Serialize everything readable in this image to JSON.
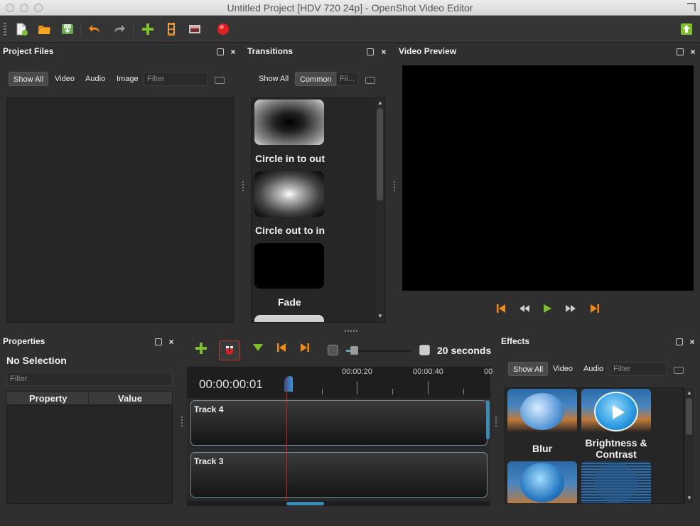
{
  "window": {
    "title": "Untitled Project [HDV 720 24p] - OpenShot Video Editor"
  },
  "toolbar": {
    "icons": [
      "new-project-icon",
      "open-project-icon",
      "save-project-icon",
      "undo-icon",
      "redo-icon",
      "import-files-icon",
      "choose-profile-icon",
      "fullscreen-icon",
      "export-video-icon",
      "update-icon"
    ]
  },
  "project_files": {
    "title": "Project Files",
    "tabs": [
      "Show All",
      "Video",
      "Audio",
      "Image"
    ],
    "active_tab": "Show All",
    "filter_placeholder": "Filter"
  },
  "transitions": {
    "title": "Transitions",
    "tabs": [
      "Show All",
      "Common"
    ],
    "active_tab": "Common",
    "filter_placeholder": "Fil...",
    "items": [
      {
        "label": "Circle in to out"
      },
      {
        "label": "Circle out to in"
      },
      {
        "label": "Fade"
      }
    ]
  },
  "video_preview": {
    "title": "Video Preview"
  },
  "properties": {
    "title": "Properties",
    "selection": "No Selection",
    "filter_placeholder": "Filter",
    "columns": [
      "Property",
      "Value"
    ]
  },
  "timeline": {
    "zoom_label": "20 seconds",
    "timecode": "00:00:00:01",
    "ruler_labels": [
      "00:00:20",
      "00:00:40",
      "00"
    ],
    "tracks": [
      {
        "name": "Track 4"
      },
      {
        "name": "Track 3"
      }
    ]
  },
  "effects": {
    "title": "Effects",
    "tabs": [
      "Show All",
      "Video",
      "Audio"
    ],
    "active_tab": "Show All",
    "filter_placeholder": "Filter",
    "items": [
      {
        "label": "Blur"
      },
      {
        "label": "Brightness & Contrast"
      }
    ]
  },
  "colors": {
    "accent_orange": "#f08a1c",
    "accent_green": "#7ec02c",
    "record_red": "#e02020",
    "playhead": "#cc2222"
  }
}
